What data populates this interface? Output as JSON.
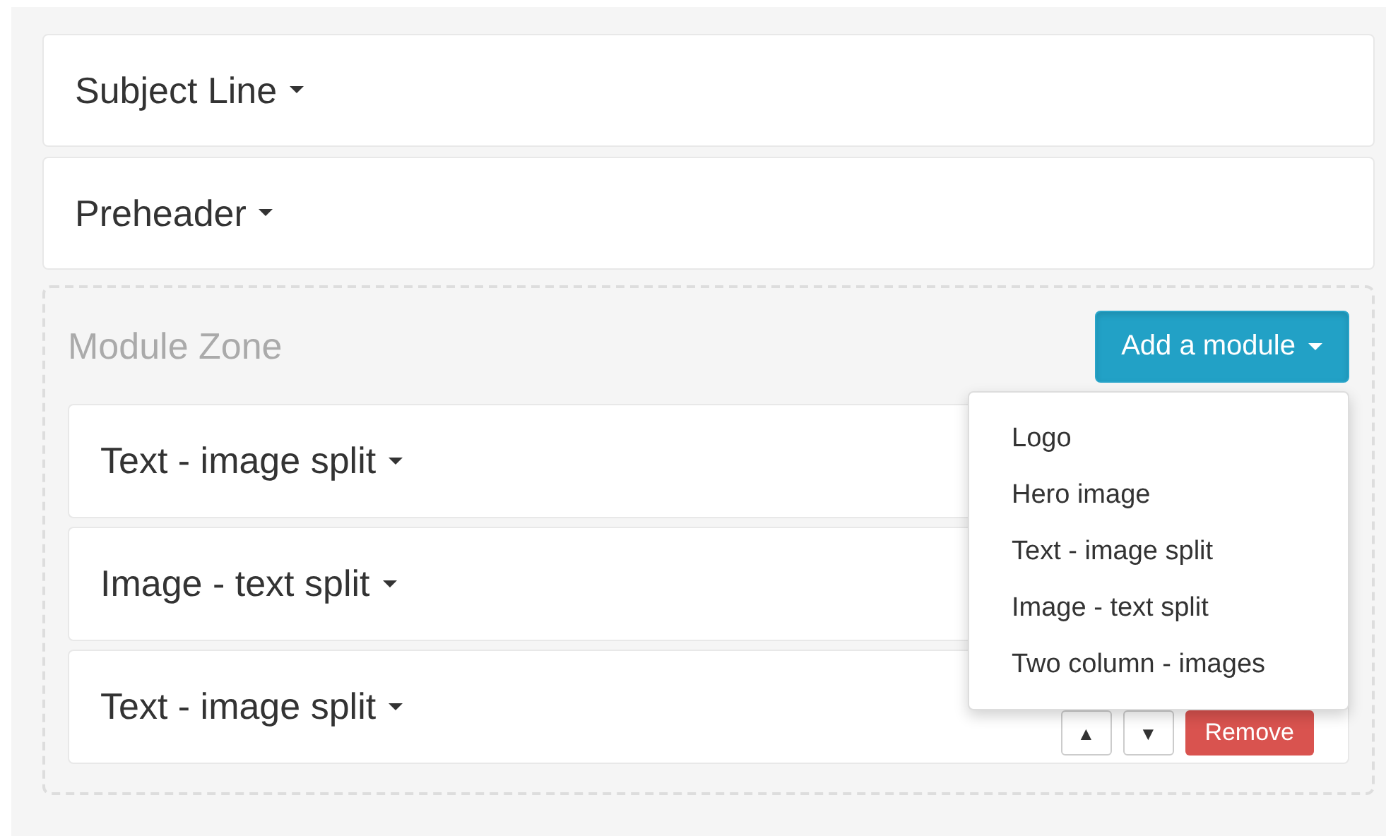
{
  "sections": [
    {
      "title": "Subject Line"
    },
    {
      "title": "Preheader"
    }
  ],
  "module_zone": {
    "title": "Module Zone",
    "add_button": {
      "label": "Add a module",
      "expanded": true
    },
    "menu": [
      {
        "label": "Logo"
      },
      {
        "label": "Hero image"
      },
      {
        "label": "Text - image split"
      },
      {
        "label": "Image - text split"
      },
      {
        "label": "Two column - images"
      }
    ],
    "modules": [
      {
        "title": "Text - image split"
      },
      {
        "title": "Image - text split"
      },
      {
        "title": "Text - image split",
        "controls": {
          "up": "▲",
          "down": "▼",
          "remove": "Remove"
        }
      }
    ]
  }
}
